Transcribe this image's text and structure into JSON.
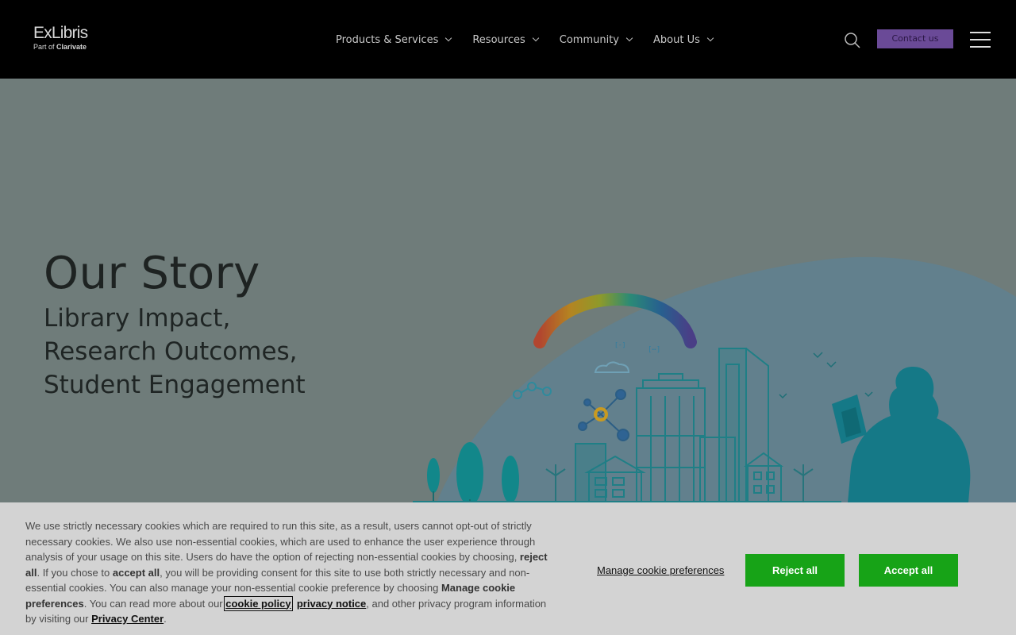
{
  "header": {
    "logo_main": "ExLibris",
    "logo_sub_prefix": "Part of ",
    "logo_sub_brand": "Clarivate",
    "nav": [
      {
        "label": "Products & Services"
      },
      {
        "label": "Resources"
      },
      {
        "label": "Community"
      },
      {
        "label": "About Us"
      }
    ],
    "contact_label": "Contact us"
  },
  "hero": {
    "title": "Our Story",
    "subtitle_lines": [
      "Library Impact,",
      "Research Outcomes,",
      "Student Engagement"
    ]
  },
  "cookie": {
    "text_1": "We use strictly necessary cookies which are required to run this site, as a result, users cannot opt-out of strictly necessary cookies. We also use non-essential cookies, which are used to enhance the user experience through analysis of your usage on this site. Users do have the option of rejecting non-essential cookies by choosing, ",
    "reject_all_bold": "reject all",
    "text_2": ". If you chose to ",
    "accept_all_bold": "accept all",
    "text_3": ", you will be providing consent for this site to use both strictly necessary and non-essential cookies. You can also manage your non-essential cookie preference by choosing ",
    "manage_bold": "Manage cookie preferences",
    "text_4": ". You can read more about our ",
    "cookie_policy": "cookie policy",
    "sep": ", ",
    "privacy_notice": "privacy notice",
    "text_5": ", and other privacy program information by visiting our ",
    "privacy_center": "Privacy Center",
    "text_6": ".",
    "manage_link": "Manage cookie preferences",
    "reject_btn": "Reject all",
    "accept_btn": "Accept all"
  },
  "colors": {
    "header_bg": "#000000",
    "contact_bg": "#6a4a97",
    "hero_bg": "#6f7c7a",
    "art_teal": "#13777f",
    "cookie_bg": "#d3d3d3",
    "button_green": "#17a317"
  }
}
